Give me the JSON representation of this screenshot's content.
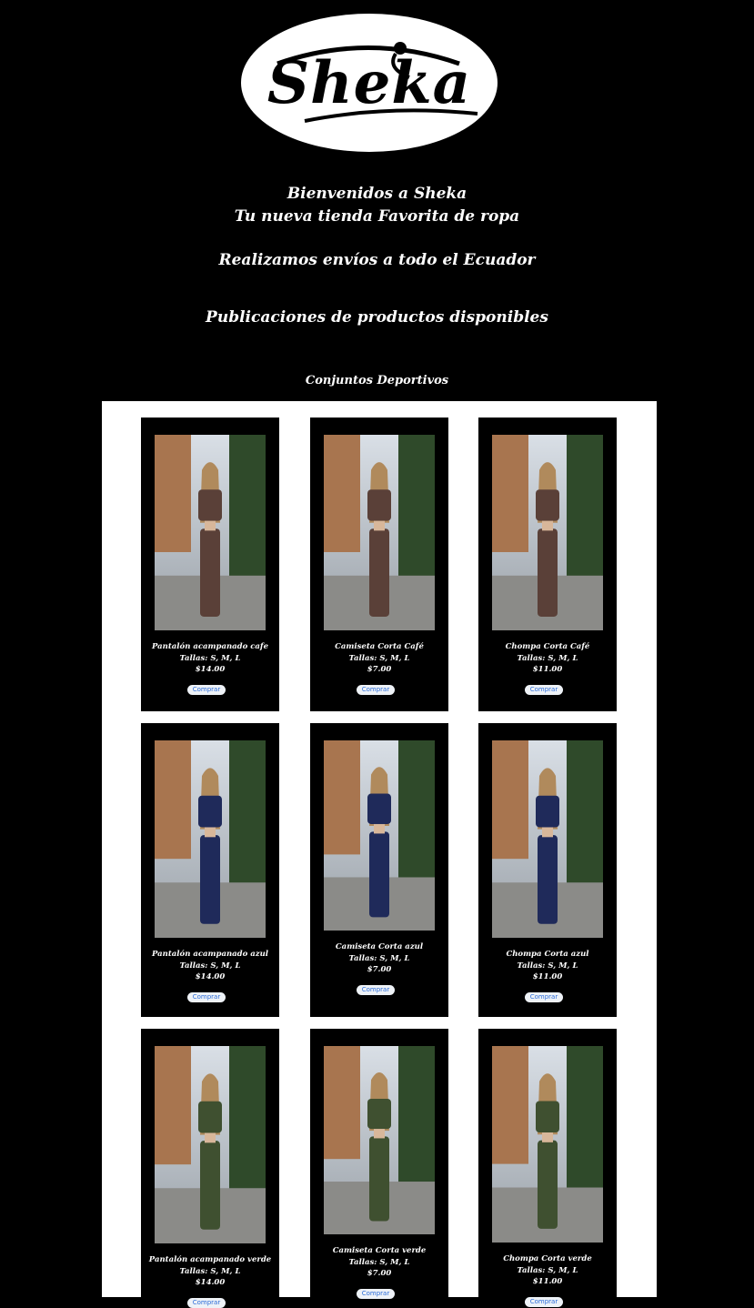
{
  "brand": {
    "logo_text": "Sheka"
  },
  "header": {
    "welcome_line1": "Bienvenidos a Sheka",
    "welcome_line2": "Tu nueva tienda Favorita de ropa",
    "shipping": "Realizamos envíos a todo el Ecuador",
    "publications": "Publicaciones de productos disponibles",
    "section_title": "Conjuntos Deportivos"
  },
  "products": [
    {
      "name": "Pantalón acampanado cafe",
      "sizes": "Tallas: S, M, L",
      "price": "$14.00",
      "button": "Comprar",
      "color": "#5a4038"
    },
    {
      "name": "Camiseta Corta Café",
      "sizes": "Tallas: S, M, L",
      "price": "$7.00",
      "button": "Comprar",
      "color": "#5a4038"
    },
    {
      "name": "Chompa Corta Café",
      "sizes": "Tallas: S, M, L",
      "price": "$11.00",
      "button": "Comprar",
      "color": "#5a4038"
    },
    {
      "name": "Pantalón acampanado azul",
      "sizes": "Tallas: S, M, L",
      "price": "$14.00",
      "button": "Comprar",
      "color": "#1f2a5a"
    },
    {
      "name": "Camiseta Corta azul",
      "sizes": "Tallas: S, M, L",
      "price": "$7.00",
      "button": "Comprar",
      "color": "#1f2a5a"
    },
    {
      "name": "Chompa Corta azul",
      "sizes": "Tallas: S, M, L",
      "price": "$11.00",
      "button": "Comprar",
      "color": "#1f2a5a"
    },
    {
      "name": "Pantalón acampanado verde",
      "sizes": "Tallas: S, M, L",
      "price": "$14.00",
      "button": "Comprar",
      "color": "#3f5030"
    },
    {
      "name": "Camiseta Corta verde",
      "sizes": "Tallas: S, M, L",
      "price": "$7.00",
      "button": "Comprar",
      "color": "#3f5030"
    },
    {
      "name": "Chompa Corta verde",
      "sizes": "Tallas: S, M, L",
      "price": "$11.00",
      "button": "Comprar",
      "color": "#3f5030"
    }
  ]
}
